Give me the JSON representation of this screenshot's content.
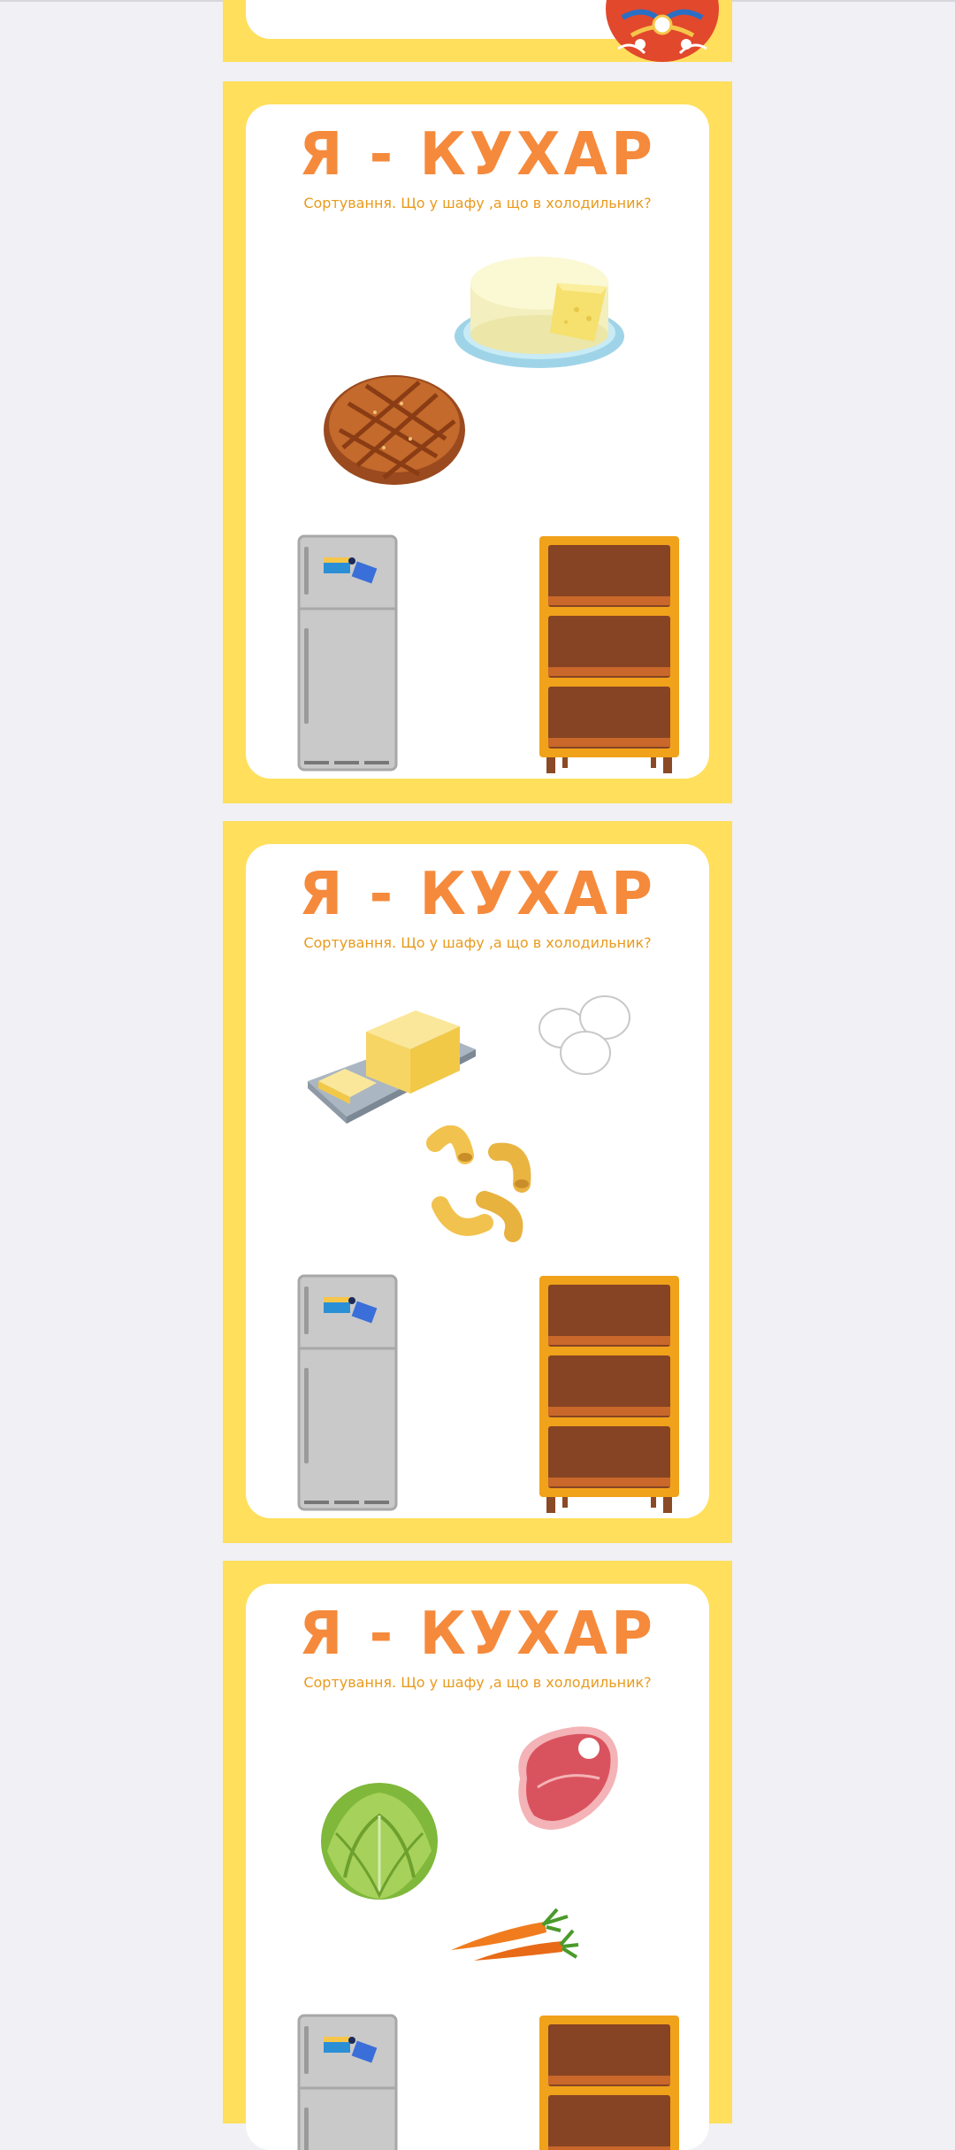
{
  "pages": [
    {
      "title": "Я - КУХАР",
      "subtitle": "Сортування. Що у шафу ,а що в холодильник?",
      "items": [
        "cheese",
        "bread"
      ]
    },
    {
      "title": "Я - КУХАР",
      "subtitle": "Сортування. Що у шафу ,а що в холодильник?",
      "items": [
        "butter",
        "eggs",
        "macaroni"
      ]
    },
    {
      "title": "Я - КУХАР",
      "subtitle": "Сортування. Що у шафу ,а що в холодильник?",
      "items": [
        "meat",
        "cabbage",
        "carrots"
      ]
    }
  ],
  "icons": {
    "fridge": "fridge-icon",
    "cabinet": "cabinet-icon",
    "decor": "painted-egg-icon"
  },
  "colors": {
    "page_background": "#f0f0f5",
    "frame": "#ffdf5c",
    "title": "#f58a3c",
    "subtitle": "#e99a1c"
  }
}
